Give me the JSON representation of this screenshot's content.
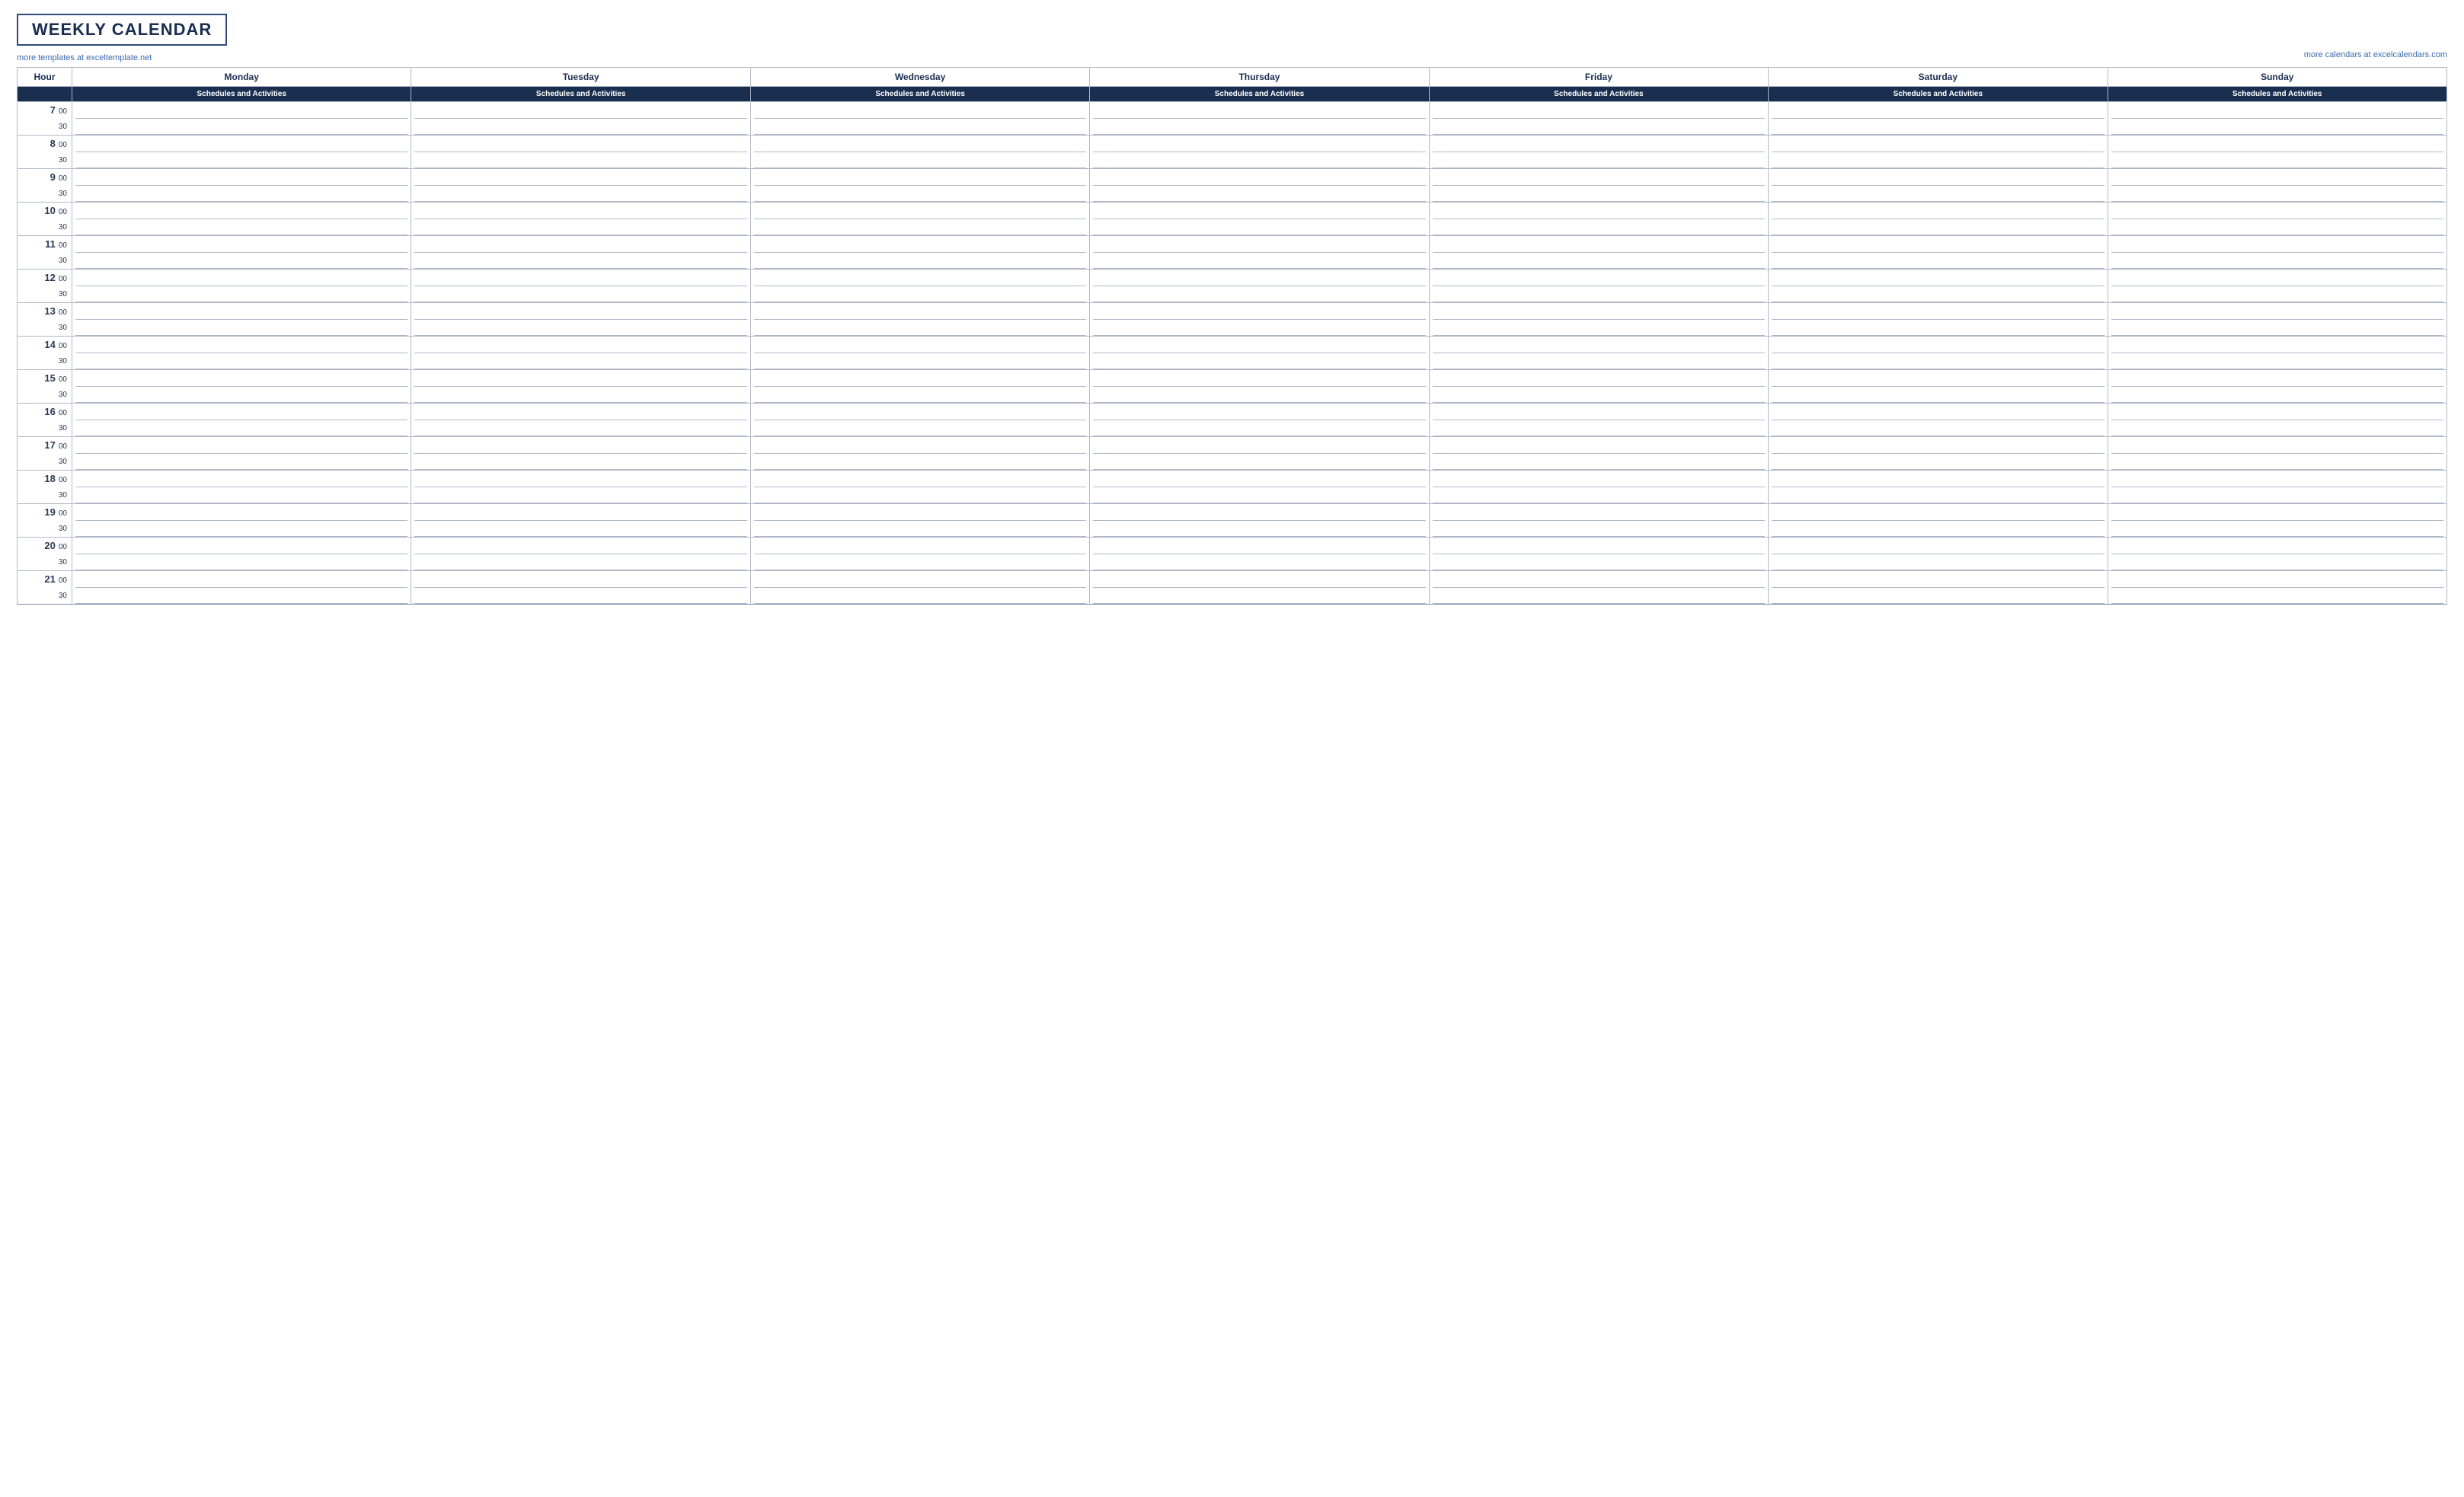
{
  "header": {
    "title": "WEEKLY CALENDAR",
    "link_left": "more templates at exceltemplate.net",
    "link_right": "more calendars at excelcalendars.com"
  },
  "table": {
    "hour_col_label": "Hour",
    "sub_row_label": "",
    "days": [
      "Monday",
      "Tuesday",
      "Wednesday",
      "Thursday",
      "Friday",
      "Saturday",
      "Sunday"
    ],
    "sub_label": "Schedules and Activities",
    "hours": [
      {
        "hour": "7",
        "min": "00"
      },
      {
        "hour": "",
        "min": "30"
      },
      {
        "hour": "8",
        "min": "00"
      },
      {
        "hour": "",
        "min": "30"
      },
      {
        "hour": "9",
        "min": "00"
      },
      {
        "hour": "",
        "min": "30"
      },
      {
        "hour": "10",
        "min": "00"
      },
      {
        "hour": "",
        "min": "30"
      },
      {
        "hour": "11",
        "min": "00"
      },
      {
        "hour": "",
        "min": "30"
      },
      {
        "hour": "12",
        "min": "00"
      },
      {
        "hour": "",
        "min": "30"
      },
      {
        "hour": "13",
        "min": "00"
      },
      {
        "hour": "",
        "min": "30"
      },
      {
        "hour": "14",
        "min": "00"
      },
      {
        "hour": "",
        "min": "30"
      },
      {
        "hour": "15",
        "min": "00"
      },
      {
        "hour": "",
        "min": "30"
      },
      {
        "hour": "16",
        "min": "00"
      },
      {
        "hour": "",
        "min": "30"
      },
      {
        "hour": "17",
        "min": "00"
      },
      {
        "hour": "",
        "min": "30"
      },
      {
        "hour": "18",
        "min": "00"
      },
      {
        "hour": "",
        "min": "30"
      },
      {
        "hour": "19",
        "min": "00"
      },
      {
        "hour": "",
        "min": "30"
      },
      {
        "hour": "20",
        "min": "00"
      },
      {
        "hour": "",
        "min": "30"
      },
      {
        "hour": "21",
        "min": "00"
      },
      {
        "hour": "",
        "min": "30"
      }
    ]
  }
}
